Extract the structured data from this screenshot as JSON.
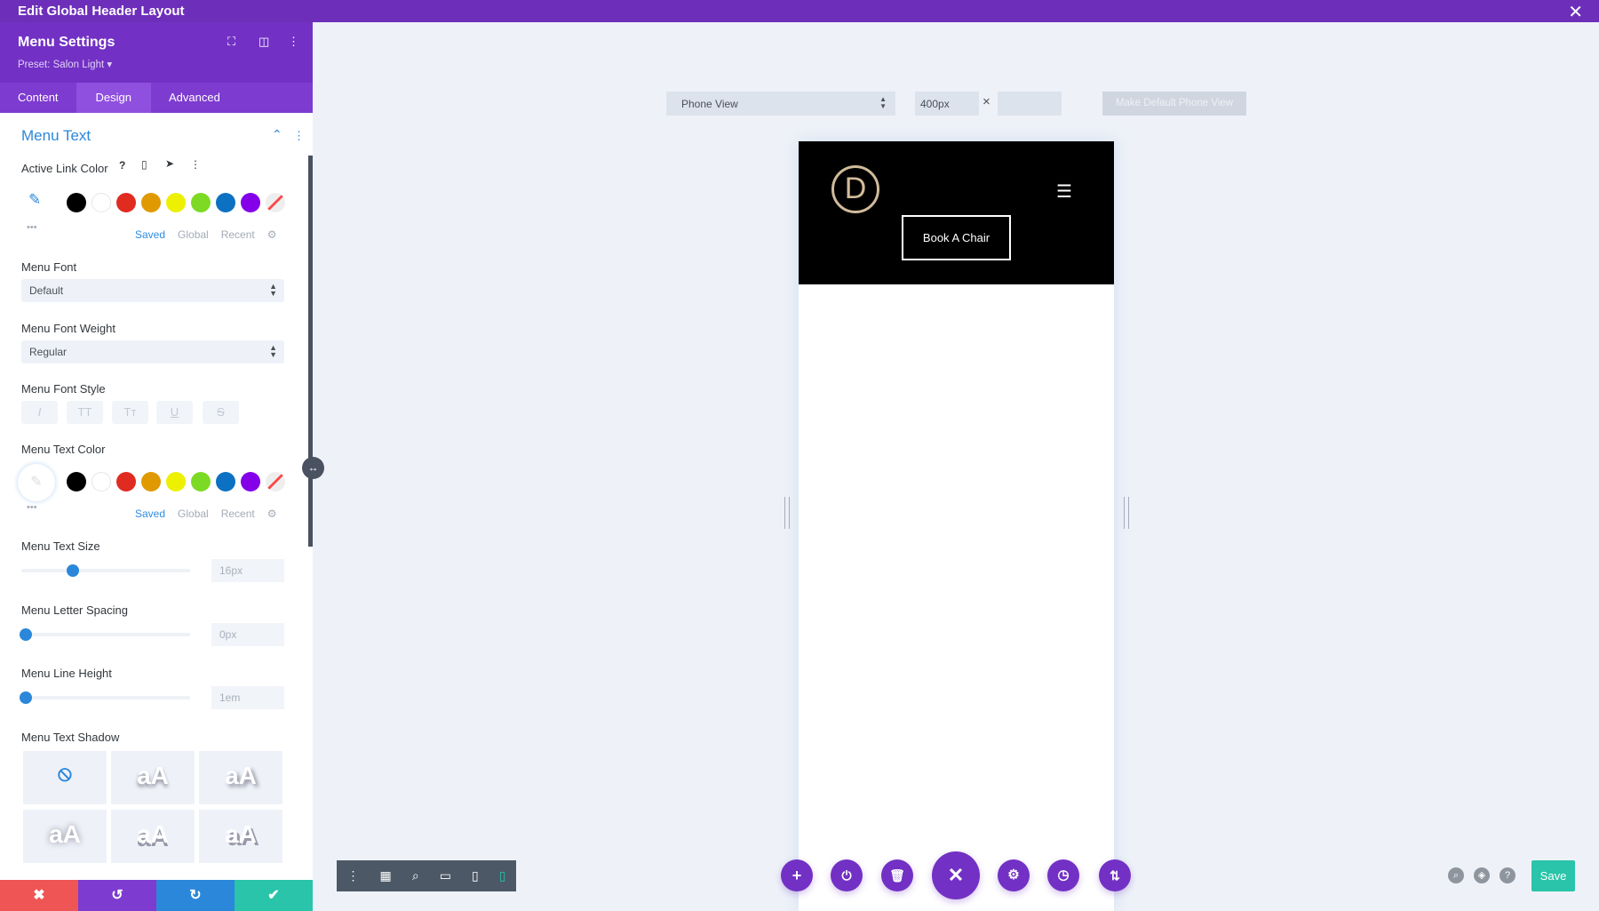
{
  "window": {
    "title": "Edit Global Header Layout",
    "close_icon": "close-icon"
  },
  "panel": {
    "title": "Menu Settings",
    "preset": "Preset: Salon Light ▾",
    "tabs": [
      "Content",
      "Design",
      "Advanced"
    ],
    "section": "Menu Text",
    "active_link_color": {
      "label": "Active Link Color",
      "help": "?",
      "more": "•••",
      "swatch_tabs": [
        "Saved",
        "Global",
        "Recent"
      ]
    },
    "swatches": [
      "#000000",
      "#ffffff",
      "#e02b20",
      "#e09900",
      "#edf000",
      "#7cda24",
      "#0c71c3",
      "#8300e9"
    ],
    "menu_font": {
      "label": "Menu Font",
      "value": "Default"
    },
    "menu_font_weight": {
      "label": "Menu Font Weight",
      "value": "Regular"
    },
    "menu_font_style": {
      "label": "Menu Font Style",
      "buttons": [
        "I",
        "TT",
        "Tт",
        "U",
        "S"
      ]
    },
    "menu_text_color": {
      "label": "Menu Text Color",
      "more": "•••",
      "swatch_tabs": [
        "Saved",
        "Global",
        "Recent"
      ]
    },
    "text_size": {
      "label": "Menu Text Size",
      "value": "16px",
      "fraction": 0.3
    },
    "letter_spacing": {
      "label": "Menu Letter Spacing",
      "value": "0px",
      "fraction": 0
    },
    "line_height": {
      "label": "Menu Line Height",
      "value": "1em",
      "fraction": 0
    },
    "text_shadow": {
      "label": "Menu Text Shadow",
      "sample": "aA",
      "none_icon": "⃠"
    }
  },
  "canvas": {
    "view_select": "Phone View",
    "width_value": "400px",
    "times": "×",
    "height_value": "",
    "make_default": "Make Default Phone View"
  },
  "preview": {
    "logo_letter": "D",
    "cta": "Book A Chair"
  },
  "footer": {
    "save": "Save"
  },
  "colors": {
    "purple": "#7231c4",
    "save": "#29c4a9",
    "cancel": "#ef5555",
    "undo": "#7e3bd0",
    "redo": "#2b87da",
    "confirm": "#29c4a9"
  }
}
